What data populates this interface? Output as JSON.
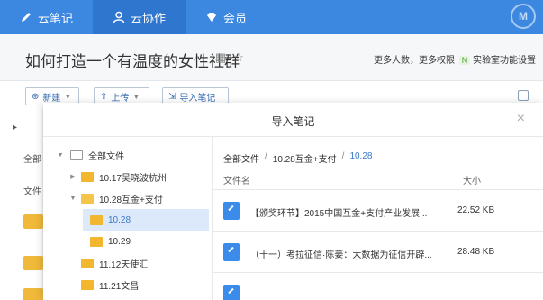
{
  "nav": {
    "tabs": [
      {
        "label": "云笔记",
        "icon": "edit-icon"
      },
      {
        "label": "云协作",
        "icon": "user-icon",
        "active": true
      },
      {
        "label": "会员",
        "icon": "diamond-icon"
      }
    ]
  },
  "header": {
    "title": "如何打造一个有温度的女性社群",
    "more_people": "更多人数，更多权限",
    "n_badge": "N",
    "lab_link": "实验室功能设置"
  },
  "toolbar": {
    "new_label": "新建",
    "upload_label": "上传",
    "import_label": "导入笔记"
  },
  "background": {
    "all_label": "全部",
    "file_label": "文件"
  },
  "modal": {
    "title": "导入笔记",
    "close_label": "×",
    "tree": [
      {
        "label": "全部文件",
        "level": 0,
        "expanded": true,
        "root": true
      },
      {
        "label": "10.17吴晓波杭州",
        "level": 1,
        "expanded": false
      },
      {
        "label": "10.28互金+支付",
        "level": 1,
        "expanded": true
      },
      {
        "label": "10.28",
        "level": 2,
        "selected": true
      },
      {
        "label": "10.29",
        "level": 2
      },
      {
        "label": "11.12天使汇",
        "level": 1
      },
      {
        "label": "11.21文昌",
        "level": 1
      }
    ],
    "breadcrumb": [
      "全部文件",
      "10.28互金+支付",
      "10.28"
    ],
    "columns": {
      "name": "文件名",
      "size": "大小"
    },
    "files": [
      {
        "name": "【颁奖环节】2015中国互金+支付产业发展...",
        "size": "22.52 KB"
      },
      {
        "name": "（十一）考拉征信·陈姜：大数据为征信开辟...",
        "size": "28.48 KB"
      },
      {
        "name": "",
        "size": ""
      }
    ]
  },
  "colors": {
    "nav": "#3c87e0",
    "accent": "#3a78c8",
    "folder": "#f2b72e",
    "file_icon": "#3b8beb"
  }
}
